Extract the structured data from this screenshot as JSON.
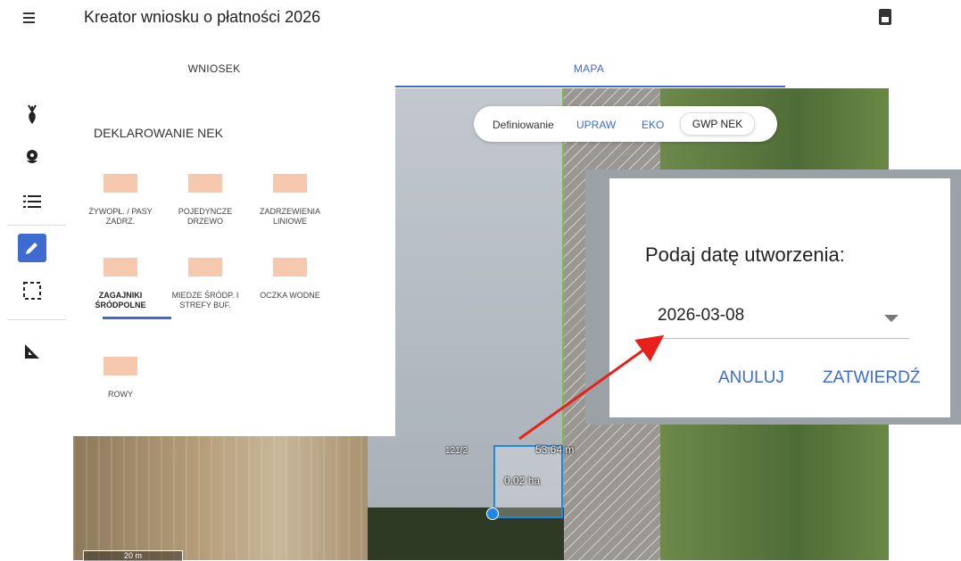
{
  "app": {
    "title": "Kreator wniosku o płatności 2026"
  },
  "tabs": [
    {
      "label": "WNIOSEK"
    },
    {
      "label": "MAPA"
    }
  ],
  "mode_switch": {
    "label": "Definiowanie",
    "options": [
      "UPRAW",
      "EKO",
      "GWP NEK"
    ],
    "selected": "GWP NEK"
  },
  "nek_panel": {
    "title": "DEKLAROWANIE NEK",
    "items": [
      {
        "label": "ŻYWOPŁ. / PASY ZADRZ.",
        "icon": "hedge-icon"
      },
      {
        "label": "POJEDYNCZE DRZEWO",
        "icon": "single-tree-icon"
      },
      {
        "label": "ZADRZEWIENIA LINIOWE",
        "icon": "tree-line-icon"
      },
      {
        "label": "ZAGAJNIKI ŚRÓDPOLNE",
        "icon": "copse-icon",
        "selected": true
      },
      {
        "label": "MIEDZE ŚRÓDP. I STREFY BUF.",
        "icon": "balk-icon"
      },
      {
        "label": "OCZKA WODNE",
        "icon": "pond-icon"
      },
      {
        "label": "ROWY",
        "icon": "ditch-icon"
      }
    ]
  },
  "map": {
    "parcel_id": "121/2",
    "segment_length": "53.64 m",
    "area": "0.02 ha",
    "scale": "20 m"
  },
  "dialog": {
    "title": "Podaj datę utworzenia:",
    "date_value": "2026-03-08",
    "cancel_label": "ANULUJ",
    "confirm_label": "ZATWIERDŹ"
  },
  "colors": {
    "accent": "#3e6bd0",
    "parcel": "#1e88e5",
    "annotation_arrow": "#e8201a",
    "nek_icon": "#f6c8ad"
  }
}
